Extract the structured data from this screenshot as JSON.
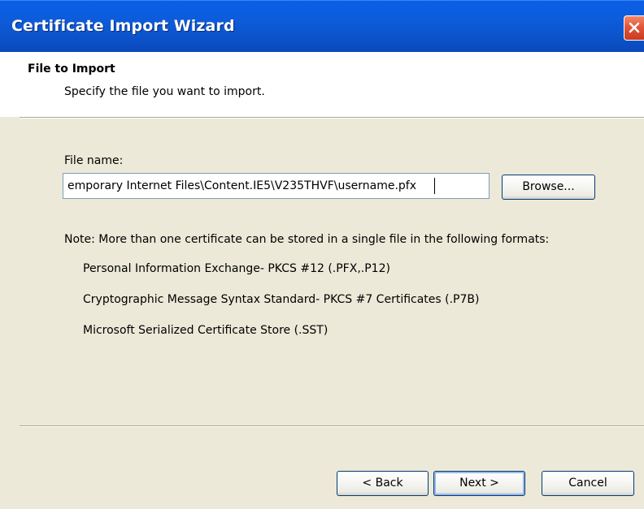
{
  "window": {
    "title": "Certificate Import Wizard"
  },
  "header": {
    "title": "File to Import",
    "subtitle": "Specify the file you want to import."
  },
  "form": {
    "file_label": "File name:",
    "file_value": "emporary Internet Files\\Content.IE5\\V235THVF\\username.pfx",
    "browse_label": "Browse..."
  },
  "note": {
    "text": "Note:  More than one certificate can be stored in a single file in the following formats:",
    "formats": [
      "Personal Information Exchange- PKCS #12 (.PFX,.P12)",
      "Cryptographic Message Syntax Standard- PKCS #7 Certificates (.P7B)",
      "Microsoft Serialized Certificate Store (.SST)"
    ]
  },
  "buttons": {
    "back": "< Back",
    "next": "Next >",
    "cancel": "Cancel"
  },
  "icons": {
    "close": "close-icon"
  },
  "colors": {
    "titlebar": "#0b58d6",
    "close": "#e2553a",
    "dialog_bg": "#ece9d8"
  }
}
